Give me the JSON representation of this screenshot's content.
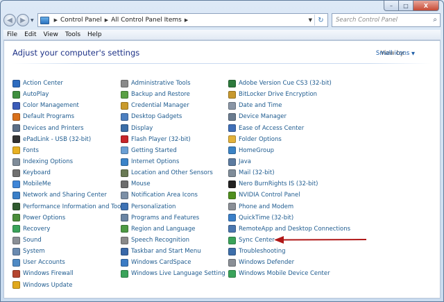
{
  "window": {
    "caption": {
      "minimize": "–",
      "maximize": "□",
      "close": "X"
    }
  },
  "nav": {
    "back": "◀",
    "forward": "▶",
    "breadcrumb": [
      "Control Panel",
      "All Control Panel Items"
    ],
    "refresh": "↻",
    "search_placeholder": "Search Control Panel"
  },
  "menu": [
    "File",
    "Edit",
    "View",
    "Tools",
    "Help"
  ],
  "header": {
    "title": "Adjust your computer's settings",
    "view_by_label": "View by:",
    "view_by_value": "Small icons"
  },
  "columns": [
    [
      {
        "label": "Action Center",
        "color": "#2d6cc0"
      },
      {
        "label": "AutoPlay",
        "color": "#3f8f3f"
      },
      {
        "label": "Color Management",
        "color": "#3a5bb8"
      },
      {
        "label": "Default Programs",
        "color": "#d9701b"
      },
      {
        "label": "Devices and Printers",
        "color": "#5b6e86"
      },
      {
        "label": "ePadLink - USB (32-bit)",
        "color": "#333333"
      },
      {
        "label": "Fonts",
        "color": "#e8b123"
      },
      {
        "label": "Indexing Options",
        "color": "#7f8c99"
      },
      {
        "label": "Keyboard",
        "color": "#707070"
      },
      {
        "label": "MobileMe",
        "color": "#3f86d8"
      },
      {
        "label": "Network and Sharing Center",
        "color": "#3a7fc8"
      },
      {
        "label": "Performance Information and Tools",
        "color": "#2f5a2f"
      },
      {
        "label": "Power Options",
        "color": "#4a8d3a"
      },
      {
        "label": "Recovery",
        "color": "#3aa35a"
      },
      {
        "label": "Sound",
        "color": "#8a8f96"
      },
      {
        "label": "System",
        "color": "#6a8ab0"
      },
      {
        "label": "User Accounts",
        "color": "#4f8ac4"
      },
      {
        "label": "Windows Firewall",
        "color": "#b5452f"
      },
      {
        "label": "Windows Update",
        "color": "#e0a81c"
      }
    ],
    [
      {
        "label": "Administrative Tools",
        "color": "#8a8a8a"
      },
      {
        "label": "Backup and Restore",
        "color": "#5aa044"
      },
      {
        "label": "Credential Manager",
        "color": "#c99a2b"
      },
      {
        "label": "Desktop Gadgets",
        "color": "#4c7fc0"
      },
      {
        "label": "Display",
        "color": "#3b6ea8"
      },
      {
        "label": "Flash Player (32-bit)",
        "color": "#c6252a"
      },
      {
        "label": "Getting Started",
        "color": "#6a9fd4"
      },
      {
        "label": "Internet Options",
        "color": "#3a83c8"
      },
      {
        "label": "Location and Other Sensors",
        "color": "#6a7a55"
      },
      {
        "label": "Mouse",
        "color": "#6d6d6d"
      },
      {
        "label": "Notification Area Icons",
        "color": "#7c8fa6"
      },
      {
        "label": "Personalization",
        "color": "#3d72b4"
      },
      {
        "label": "Programs and Features",
        "color": "#6a84a3"
      },
      {
        "label": "Region and Language",
        "color": "#4e9a44"
      },
      {
        "label": "Speech Recognition",
        "color": "#8a8a8a"
      },
      {
        "label": "Taskbar and Start Menu",
        "color": "#3968a8"
      },
      {
        "label": "Windows CardSpace",
        "color": "#3b7bc4"
      },
      {
        "label": "Windows Live Language Setting",
        "color": "#3aa35a"
      }
    ],
    [
      {
        "label": "Adobe Version Cue CS3 (32-bit)",
        "color": "#2d7a3c"
      },
      {
        "label": "BitLocker Drive Encryption",
        "color": "#c7992f"
      },
      {
        "label": "Date and Time",
        "color": "#8a96a6"
      },
      {
        "label": "Device Manager",
        "color": "#6b7c90"
      },
      {
        "label": "Ease of Access Center",
        "color": "#3f6fb8"
      },
      {
        "label": "Folder Options",
        "color": "#e3b23a"
      },
      {
        "label": "HomeGroup",
        "color": "#3b83c6"
      },
      {
        "label": "Java",
        "color": "#5c7ba0"
      },
      {
        "label": "Mail (32-bit)",
        "color": "#7f8c99"
      },
      {
        "label": "Nero BurnRights IS (32-bit)",
        "color": "#222222"
      },
      {
        "label": "NVIDIA Control Panel",
        "color": "#4f8f1f"
      },
      {
        "label": "Phone and Modem",
        "color": "#8a8f96"
      },
      {
        "label": "QuickTime (32-bit)",
        "color": "#3a7fc8"
      },
      {
        "label": "RemoteApp and Desktop Connections",
        "color": "#4a77b0"
      },
      {
        "label": "Sync Center",
        "color": "#3aa35a"
      },
      {
        "label": "Troubleshooting",
        "color": "#3d6eaa"
      },
      {
        "label": "Windows Defender",
        "color": "#8a8f96"
      },
      {
        "label": "Windows Mobile Device Center",
        "color": "#3aa35a"
      }
    ]
  ],
  "annotation_color": "#b01818"
}
